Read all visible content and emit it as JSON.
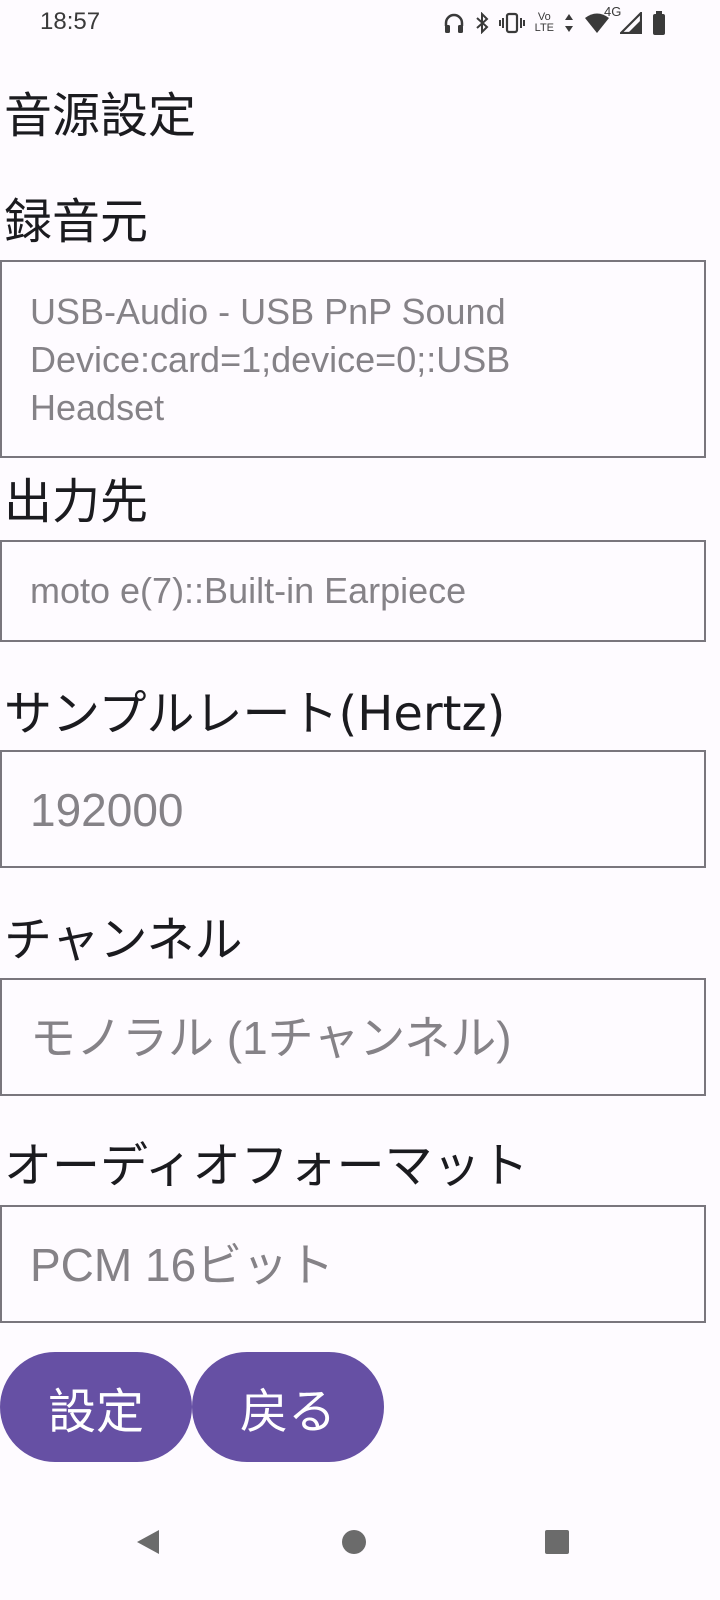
{
  "status_bar": {
    "time": "18:57",
    "icons": [
      "headphones-icon",
      "bluetooth-icon",
      "vibrate-icon",
      "volte-icon",
      "data-arrows-icon",
      "wifi-icon",
      "4g-icon",
      "cell-signal-icon",
      "battery-icon"
    ],
    "volte_top": "Vo",
    "volte_bottom": "LTE",
    "network_label": "4G"
  },
  "page": {
    "title": "音源設定"
  },
  "source": {
    "label": "録音元",
    "value_lines": [
      "USB-Audio - USB PnP Sound",
      "Device:card=1;device=0;:USB",
      "Headset"
    ]
  },
  "output": {
    "label": "出力先",
    "value": "moto e(7)::Built-in Earpiece"
  },
  "sample_rate": {
    "label": "サンプルレート(Hertz)",
    "value": "192000"
  },
  "channel": {
    "label": "チャンネル",
    "value": "モノラル (1チャンネル)"
  },
  "format": {
    "label": "オーディオフォーマット",
    "value": "PCM 16ビット"
  },
  "buttons": {
    "set_label": "設定",
    "back_label": "戻る"
  },
  "colors": {
    "accent": "#6650a4",
    "background": "#fefbff",
    "field_border": "#79767d",
    "field_text": "#858287",
    "heading_text": "#1b1b1f"
  }
}
